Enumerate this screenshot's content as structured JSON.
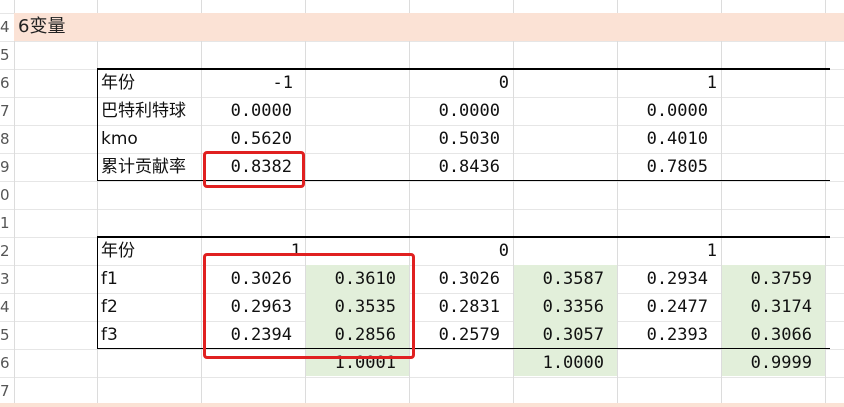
{
  "row_numbers": [
    "",
    "4",
    "5",
    "6",
    "7",
    "8",
    "9",
    "0",
    "1",
    "2",
    "3",
    "4",
    "5",
    "6",
    "7"
  ],
  "band_title": "6变量",
  "table1": {
    "header_label": "年份",
    "years": [
      "-1",
      "0",
      "1"
    ],
    "rows": [
      {
        "label": "巴特利特球",
        "values": [
          "0.0000",
          "0.0000",
          "0.0000"
        ]
      },
      {
        "label": "kmo",
        "values": [
          "0.5620",
          "0.5030",
          "0.4010"
        ]
      },
      {
        "label": "累计贡献率",
        "values": [
          "0.8382",
          "0.8436",
          "0.7805"
        ]
      }
    ]
  },
  "table2": {
    "header_label": "年份",
    "years": [
      "1",
      "0",
      "1"
    ],
    "rows": [
      {
        "label": "f1",
        "values": [
          "0.3026",
          "0.3610",
          "0.3026",
          "0.3587",
          "0.2934",
          "0.3759"
        ]
      },
      {
        "label": "f2",
        "values": [
          "0.2963",
          "0.3535",
          "0.2831",
          "0.3356",
          "0.2477",
          "0.3174"
        ]
      },
      {
        "label": "f3",
        "values": [
          "0.2394",
          "0.2856",
          "0.2579",
          "0.3057",
          "0.2393",
          "0.3066"
        ]
      }
    ],
    "sums": [
      "1.0001",
      "1.0000",
      "0.9999"
    ]
  },
  "colors": {
    "highlight_band": "#fbe2d5",
    "green_fill": "#e2efda",
    "annotation_red": "#e02020"
  }
}
